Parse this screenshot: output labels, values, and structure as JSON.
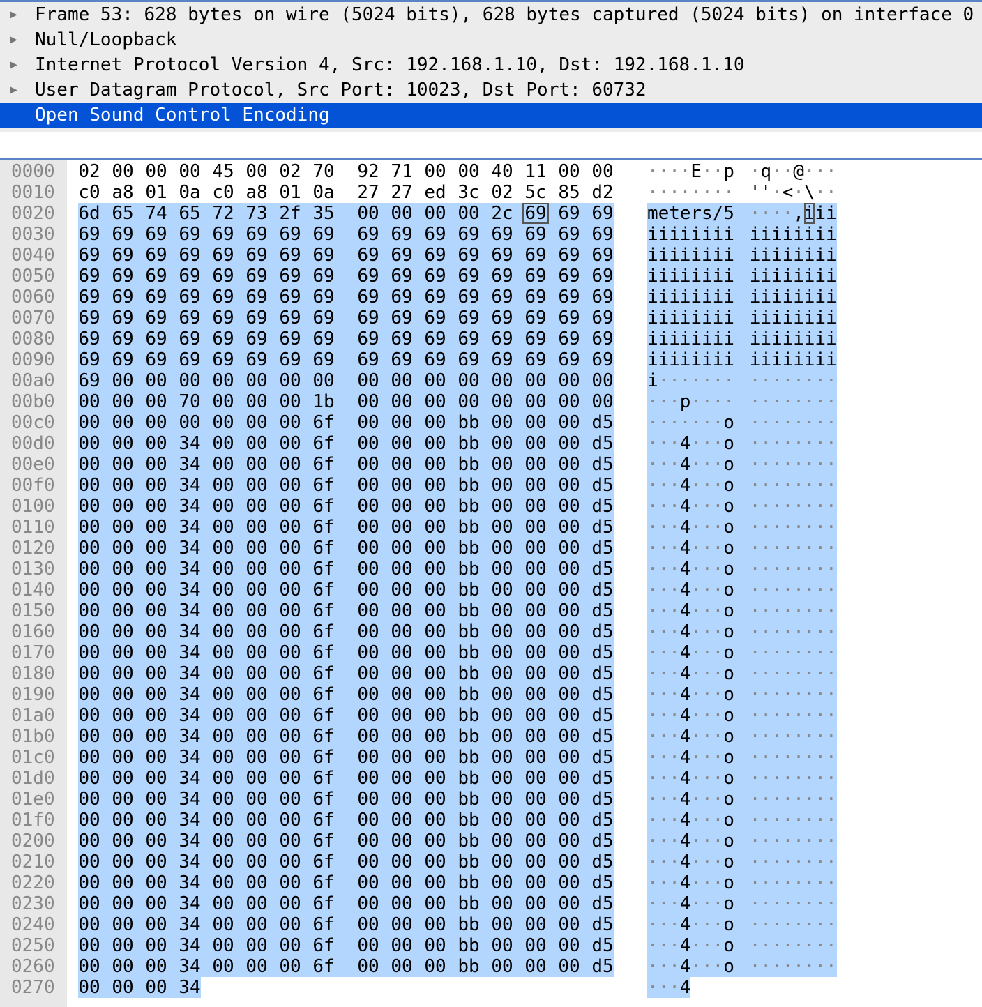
{
  "packet_tree": {
    "rows": [
      {
        "label": "Frame 53: 628 bytes on wire (5024 bits), 628 bytes captured (5024 bits) on interface 0",
        "expandable": true
      },
      {
        "label": "Null/Loopback",
        "expandable": true
      },
      {
        "label": "Internet Protocol Version 4, Src: 192.168.1.10, Dst: 192.168.1.10",
        "expandable": true
      },
      {
        "label": "User Datagram Protocol, Src Port: 10023, Dst Port: 60732",
        "expandable": true
      },
      {
        "label": "Open Sound Control Encoding",
        "expandable": false,
        "selected": true
      }
    ],
    "expand_icon": "triangle-right-icon"
  },
  "byte_view": {
    "hex_rows": [
      "02 00 00 00 45 00 02 70 92 71 00 00 40 11 00 00",
      "c0 a8 01 0a c0 a8 01 0a 27 27 ed 3c 02 5c 85 d2",
      "6d 65 74 65 72 73 2f 35 00 00 00 00 2c 69 69 69",
      "69 69 69 69 69 69 69 69 69 69 69 69 69 69 69 69",
      "69 69 69 69 69 69 69 69 69 69 69 69 69 69 69 69",
      "69 69 69 69 69 69 69 69 69 69 69 69 69 69 69 69",
      "69 69 69 69 69 69 69 69 69 69 69 69 69 69 69 69",
      "69 69 69 69 69 69 69 69 69 69 69 69 69 69 69 69",
      "69 69 69 69 69 69 69 69 69 69 69 69 69 69 69 69",
      "69 69 69 69 69 69 69 69 69 69 69 69 69 69 69 69",
      "69 00 00 00 00 00 00 00 00 00 00 00 00 00 00 00",
      "00 00 00 70 00 00 00 1b 00 00 00 00 00 00 00 00",
      "00 00 00 00 00 00 00 6f 00 00 00 bb 00 00 00 d5",
      "00 00 00 34 00 00 00 6f 00 00 00 bb 00 00 00 d5",
      "00 00 00 34 00 00 00 6f 00 00 00 bb 00 00 00 d5",
      "00 00 00 34 00 00 00 6f 00 00 00 bb 00 00 00 d5",
      "00 00 00 34 00 00 00 6f 00 00 00 bb 00 00 00 d5",
      "00 00 00 34 00 00 00 6f 00 00 00 bb 00 00 00 d5",
      "00 00 00 34 00 00 00 6f 00 00 00 bb 00 00 00 d5",
      "00 00 00 34 00 00 00 6f 00 00 00 bb 00 00 00 d5",
      "00 00 00 34 00 00 00 6f 00 00 00 bb 00 00 00 d5",
      "00 00 00 34 00 00 00 6f 00 00 00 bb 00 00 00 d5",
      "00 00 00 34 00 00 00 6f 00 00 00 bb 00 00 00 d5",
      "00 00 00 34 00 00 00 6f 00 00 00 bb 00 00 00 d5",
      "00 00 00 34 00 00 00 6f 00 00 00 bb 00 00 00 d5",
      "00 00 00 34 00 00 00 6f 00 00 00 bb 00 00 00 d5",
      "00 00 00 34 00 00 00 6f 00 00 00 bb 00 00 00 d5",
      "00 00 00 34 00 00 00 6f 00 00 00 bb 00 00 00 d5",
      "00 00 00 34 00 00 00 6f 00 00 00 bb 00 00 00 d5",
      "00 00 00 34 00 00 00 6f 00 00 00 bb 00 00 00 d5",
      "00 00 00 34 00 00 00 6f 00 00 00 bb 00 00 00 d5",
      "00 00 00 34 00 00 00 6f 00 00 00 bb 00 00 00 d5",
      "00 00 00 34 00 00 00 6f 00 00 00 bb 00 00 00 d5",
      "00 00 00 34 00 00 00 6f 00 00 00 bb 00 00 00 d5",
      "00 00 00 34 00 00 00 6f 00 00 00 bb 00 00 00 d5",
      "00 00 00 34 00 00 00 6f 00 00 00 bb 00 00 00 d5",
      "00 00 00 34 00 00 00 6f 00 00 00 bb 00 00 00 d5",
      "00 00 00 34 00 00 00 6f 00 00 00 bb 00 00 00 d5",
      "00 00 00 34 00 00 00 6f 00 00 00 bb 00 00 00 d5",
      "00 00 00 34"
    ],
    "selection_start_byte": 32,
    "cursor_byte": 45,
    "nonprintable_char": "·"
  },
  "colors": {
    "tree_background": "#ececec",
    "selected_row": "#0452d6",
    "selected_text": "#ffffff",
    "byte_highlight": "#b3d6ff",
    "offset_column": "#e8e8e8",
    "divider": "#5b84c6"
  }
}
